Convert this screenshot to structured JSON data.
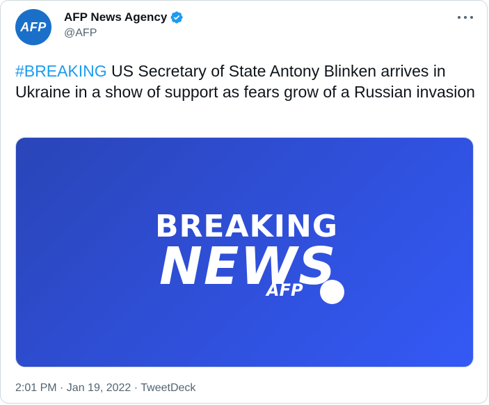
{
  "author": {
    "avatar_text": "AFP",
    "name": "AFP News Agency",
    "handle": "@AFP"
  },
  "tweet": {
    "hashtag": "#BREAKING",
    "text": " US Secretary of State Antony Blinken arrives in Ukraine in a show of support as fears grow of a Russian invasion"
  },
  "media": {
    "line1": "BREAKING",
    "line2": "NEWS",
    "brand": "AFP"
  },
  "meta": {
    "time": "2:01 PM · Jan 19, 2022 · TweetDeck"
  },
  "colors": {
    "accent": "#1d9bf0",
    "avatar_bg": "#1a70c9",
    "media_bg": "#2f4fd8"
  },
  "icons": [
    "verified-badge-icon",
    "more-options-icon"
  ]
}
